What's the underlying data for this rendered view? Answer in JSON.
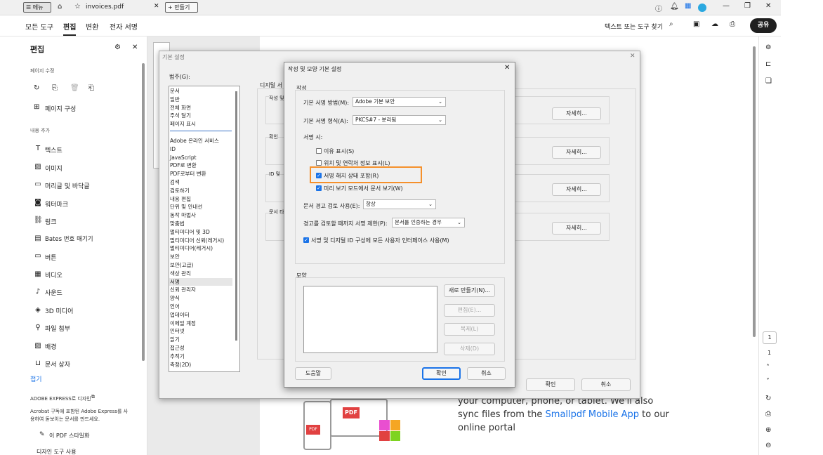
{
  "titlebar": {
    "menu": "메뉴",
    "tab_title": "invoices.pdf",
    "new_tab": "만들기"
  },
  "toolbar": {
    "tabs": [
      "모든 도구",
      "편집",
      "변환",
      "전자 서명"
    ],
    "search": "텍스트 또는 도구 찾기",
    "share": "공유"
  },
  "leftpanel": {
    "title": "편집",
    "section_pages": "페이지 수정",
    "page_organize": "페이지 구성",
    "section_add": "내용 추가",
    "items": [
      "텍스트",
      "이미지",
      "머리글 및 바닥글",
      "워터마크",
      "링크",
      "Bates 번호 매기기",
      "버튼",
      "비디오",
      "사운드",
      "3D 미디어",
      "파일 첨부",
      "배경",
      "문서 상자"
    ],
    "collapse": "접기",
    "express_title": "ADOBE EXPRESS로 디자인",
    "express_desc1": "Acrobat 구독에 포함된 Adobe Express를 사",
    "express_desc2": "용하여 돋보이는 문서를 만드세요.",
    "express_item1": "이 PDF 스타일화",
    "express_item2": "디자인 도구 사용"
  },
  "pref": {
    "title": "기본 설정",
    "category_label": "범주(G):",
    "categories_top": [
      "문서",
      "일반",
      "전체 화면",
      "주석 달기",
      "페이지 표시"
    ],
    "categories": [
      "Adobe 온라인 서비스",
      "ID",
      "JavaScript",
      "PDF로 변환",
      "PDF로부터 변환",
      "검색",
      "검토하기",
      "내용 편집",
      "단위 및 안내선",
      "동작 마법사",
      "맞춤법",
      "멀티미디어 및 3D",
      "멀티미디어 신뢰(레거시)",
      "멀티미디어(레거시)",
      "보안",
      "보안(고급)",
      "색상 관리",
      "서명",
      "신뢰 관리자",
      "양식",
      "언어",
      "업데이터",
      "이메일 계정",
      "인터넷",
      "읽기",
      "접근성",
      "추적기",
      "측정(2D)"
    ],
    "selected_category": "서명",
    "section1": "디지털 서",
    "g1": "작성 및",
    "g2": "확인",
    "g3": "ID 및",
    "g4": "문서 타",
    "more": "자세히...",
    "ok": "확인",
    "cancel": "취소"
  },
  "sig": {
    "title": "작성 및 모양 기본 설정",
    "section_create": "작성",
    "method_label": "기본 서명 방법(M):",
    "method_value": "Adobe 기본 보안",
    "format_label": "기본 서명 형식(A):",
    "format_value": "PKCS#7 - 분리됨",
    "when_signing": "서명 시:",
    "opt1": "이유 표시(S)",
    "opt2": "위치 및 연락처 정보 표시(L)",
    "opt3": "서명 해지 상태 포함(R)",
    "opt4": "미리 보기 모드에서 문서 보기(W)",
    "warn_label": "문서 경고 검토 사용(E):",
    "warn_value": "항상",
    "prevent_label": "경고를 검토할 때까지 서명 제한(P):",
    "prevent_value": "문서를 인증하는 경우",
    "opt5": "서명 및 디지털 ID 구성에 모든 사용자 인터페이스 사용(M)",
    "section_appearance": "모양",
    "new": "새로 만들기(N)...",
    "edit": "편집(E)...",
    "copy": "복제(L)",
    "delete": "삭제(D)",
    "help": "도움말",
    "ok": "확인",
    "cancel": "취소"
  },
  "doc": {
    "text1": "your computer, phone, or tablet. We'll also",
    "text2a": "sync files from the ",
    "link": "Smallpdf Mobile App",
    "text2b": " to our",
    "text3": "online portal",
    "pdf_badge": "PDF"
  },
  "rail": {
    "page_current": "1",
    "page_total": "1"
  },
  "colors": {
    "accent": "#1a73e8",
    "highlight": "#f5902b",
    "selected": "#e6e6e6"
  }
}
